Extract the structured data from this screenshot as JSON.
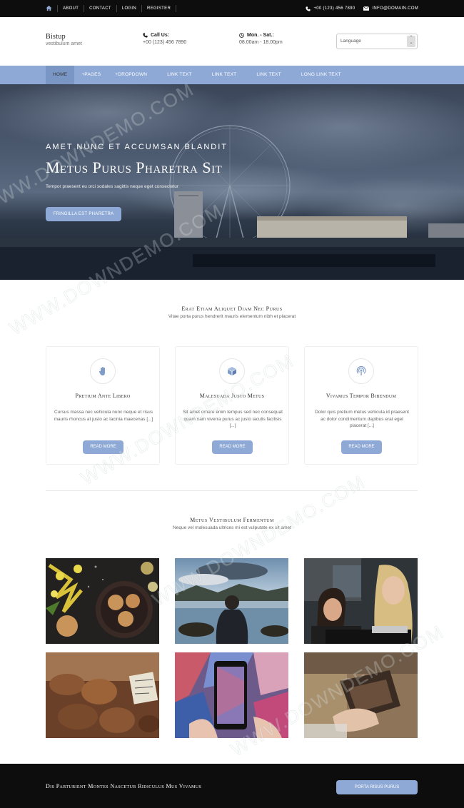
{
  "topbar": {
    "links": [
      "ABOUT",
      "CONTACT",
      "LOGIN",
      "REGISTER"
    ],
    "phone": "+00 (123) 456 7890",
    "email": "INFO@DOMAIN.COM"
  },
  "header": {
    "logo_title": "Bistup",
    "logo_sub": "vestibulum amet",
    "call_label": "Call Us:",
    "call_value": "+00 (123) 456 7890",
    "hours_label": "Mon. - Sat.:",
    "hours_value": "08.00am - 18.00pm",
    "language": "Language"
  },
  "nav": {
    "items": [
      "HOME",
      "+PAGES",
      "+DROPDOWN",
      "LINK TEXT",
      "LINK TEXT",
      "LINK TEXT",
      "LONG LINK TEXT"
    ]
  },
  "hero": {
    "pretitle": "Amet nunc et accumsan blandit",
    "title": "Metus Purus Pharetra Sit",
    "subtitle": "Tempor praesent eu orci sodales sagittis neque eget consectetur",
    "button": "FRINGILLA EST PHARETRA"
  },
  "features": {
    "title": "Erat Etiam Aliquet Diam Nec Purus",
    "subtitle": "Vitae porta purus hendrerit mauris elementum nibh et placerat",
    "cards": [
      {
        "title": "Pretium Ante Libero",
        "text": "Cursus massa nec vehicula nunc neque et risus mauris rhoncus at justo ac lacinia maecenas [...]",
        "button": "READ MORE",
        "icon": "hand-icon"
      },
      {
        "title": "Malesuada Justo Metus",
        "text": "Sit amet ornare enim tempus sed nec consequat quam nam viverra purus ac justo iaculis facilisis [...]",
        "button": "READ MORE",
        "icon": "cube-icon"
      },
      {
        "title": "Vivamus Tempor Bibendum",
        "text": "Dolor quis pretium metus vehicula id praesent ac dolor condimentum dapibus erat eget placerat [...]",
        "button": "READ MORE",
        "icon": "broadcast-icon"
      }
    ]
  },
  "gallery": {
    "title": "Metus Vestibulum Fermentum",
    "subtitle": "Neque vel malesuada ultrices mi est vulputate ex sit amet"
  },
  "footer": {
    "text": "Dis Parturient Montes Nascetur Ridiculus Mus Vivamus",
    "button": "PORTA RISUS PURUS"
  },
  "watermark": "WWW.DOWNDEMO.COM",
  "colors": {
    "accent": "#8ea9d6",
    "dark": "#0d0d0d"
  }
}
